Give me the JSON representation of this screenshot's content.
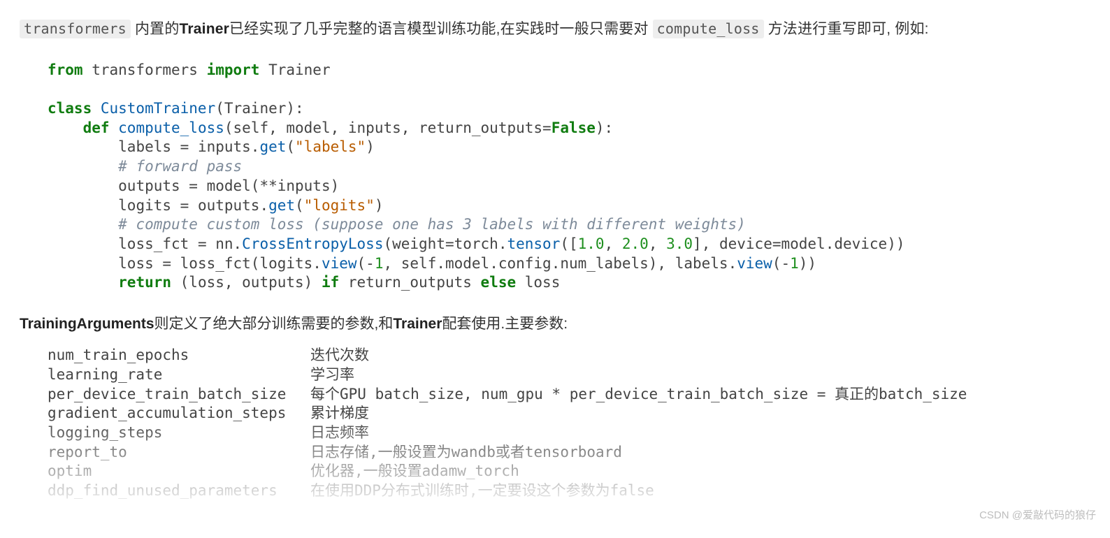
{
  "intro": {
    "chip1": "transformers",
    "t1": " 内置的",
    "b1": "Trainer",
    "t2": "已经实现了几乎完整的语言模型训练功能,在实践时一般只需要对 ",
    "chip2": "compute_loss",
    "t3": " 方法进行重写即可, 例如:"
  },
  "code": {
    "l1_from": "from",
    "l1_mod": " transformers ",
    "l1_import": "import",
    "l1_name": " Trainer",
    "l3_class": "class",
    "l3_name": " CustomTrainer",
    "l3_rest": "(Trainer):",
    "l4_def": "def",
    "l4_fn": " compute_loss",
    "l4_sig1": "(self, model, inputs, return_outputs=",
    "l4_false": "False",
    "l4_sig2": "):",
    "l5_a": "labels = inputs.",
    "l5_get": "get",
    "l5_op": "(",
    "l5_str": "\"labels\"",
    "l5_cl": ")",
    "l6_cmt": "# forward pass",
    "l7": "outputs = model(**inputs)",
    "l8_a": "logits = outputs.",
    "l8_get": "get",
    "l8_op": "(",
    "l8_str": "\"logits\"",
    "l8_cl": ")",
    "l9_cmt": "# compute custom loss (suppose one has 3 labels with different weights)",
    "l10_a": "loss_fct = nn.",
    "l10_fn": "CrossEntropyLoss",
    "l10_b": "(weight=torch.",
    "l10_t": "tensor",
    "l10_c": "([",
    "l10_n1": "1.0",
    "l10_s1": ", ",
    "l10_n2": "2.0",
    "l10_s2": ", ",
    "l10_n3": "3.0",
    "l10_d": "], device=model.device))",
    "l11_a": "loss = loss_fct(logits.",
    "l11_v1": "view",
    "l11_b": "(-",
    "l11_n1": "1",
    "l11_c": ", self.model.config.num_labels), labels.",
    "l11_v2": "view",
    "l11_d": "(-",
    "l11_n2": "1",
    "l11_e": "))",
    "l12_ret": "return",
    "l12_a": " (loss, outputs) ",
    "l12_if": "if",
    "l12_b": " return_outputs ",
    "l12_else": "else",
    "l12_c": " loss"
  },
  "para2": {
    "b1": "TrainingArguments",
    "t1": "则定义了绝大部分训练需要的参数,和",
    "b2": "Trainer",
    "t2": "配套使用.主要参数:"
  },
  "args": [
    {
      "name": "num_train_epochs",
      "desc": "迭代次数"
    },
    {
      "name": "learning_rate",
      "desc": "学习率"
    },
    {
      "name": "per_device_train_batch_size",
      "desc": "每个GPU batch_size, num_gpu * per_device_train_batch_size = 真正的batch_size"
    },
    {
      "name": "gradient_accumulation_steps",
      "desc": "累计梯度"
    },
    {
      "name": "logging_steps",
      "desc": "日志频率"
    },
    {
      "name": "report_to",
      "desc": "日志存储,一般设置为wandb或者tensorboard"
    },
    {
      "name": "optim",
      "desc": "优化器,一般设置adamw_torch"
    },
    {
      "name": "ddp_find_unused_parameters",
      "desc": "在使用DDP分布式训练时,一定要设这个参数为false"
    }
  ],
  "credit": "CSDN @爱敲代码的狼仔"
}
